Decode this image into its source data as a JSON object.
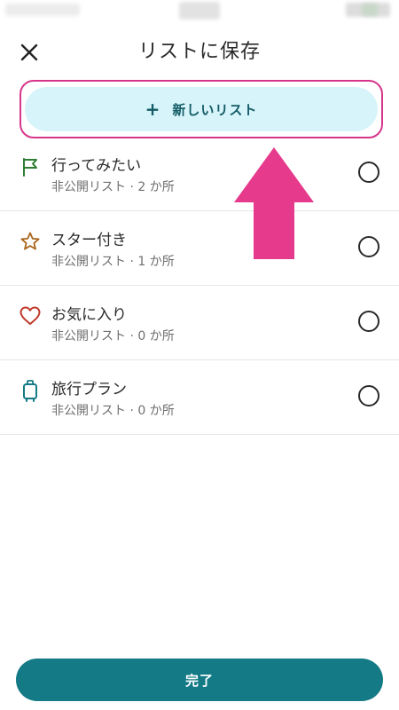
{
  "header": {
    "title": "リストに保存",
    "close_icon": "close-icon"
  },
  "new_list": {
    "plus": "+",
    "label": "新しいリスト"
  },
  "lists": [
    {
      "name": "行ってみたい",
      "meta": "非公開リスト · 2 か所",
      "icon": "flag-icon",
      "color": "#2e7d32",
      "selected": false
    },
    {
      "name": "スター付き",
      "meta": "非公開リスト · 1 か所",
      "icon": "star-icon",
      "color": "#a8651a",
      "selected": false
    },
    {
      "name": "お気に入り",
      "meta": "非公開リスト · 0 か所",
      "icon": "heart-icon",
      "color": "#c0392b",
      "selected": false
    },
    {
      "name": "旅行プラン",
      "meta": "非公開リスト · 0 か所",
      "icon": "suitcase-icon",
      "color": "#137a86",
      "selected": false
    }
  ],
  "footer": {
    "done_label": "完了"
  },
  "colors": {
    "accent": "#137a86",
    "highlight": "#d6358a",
    "new_list_bg": "#d7f4fa",
    "arrow": "#e63a8c"
  }
}
